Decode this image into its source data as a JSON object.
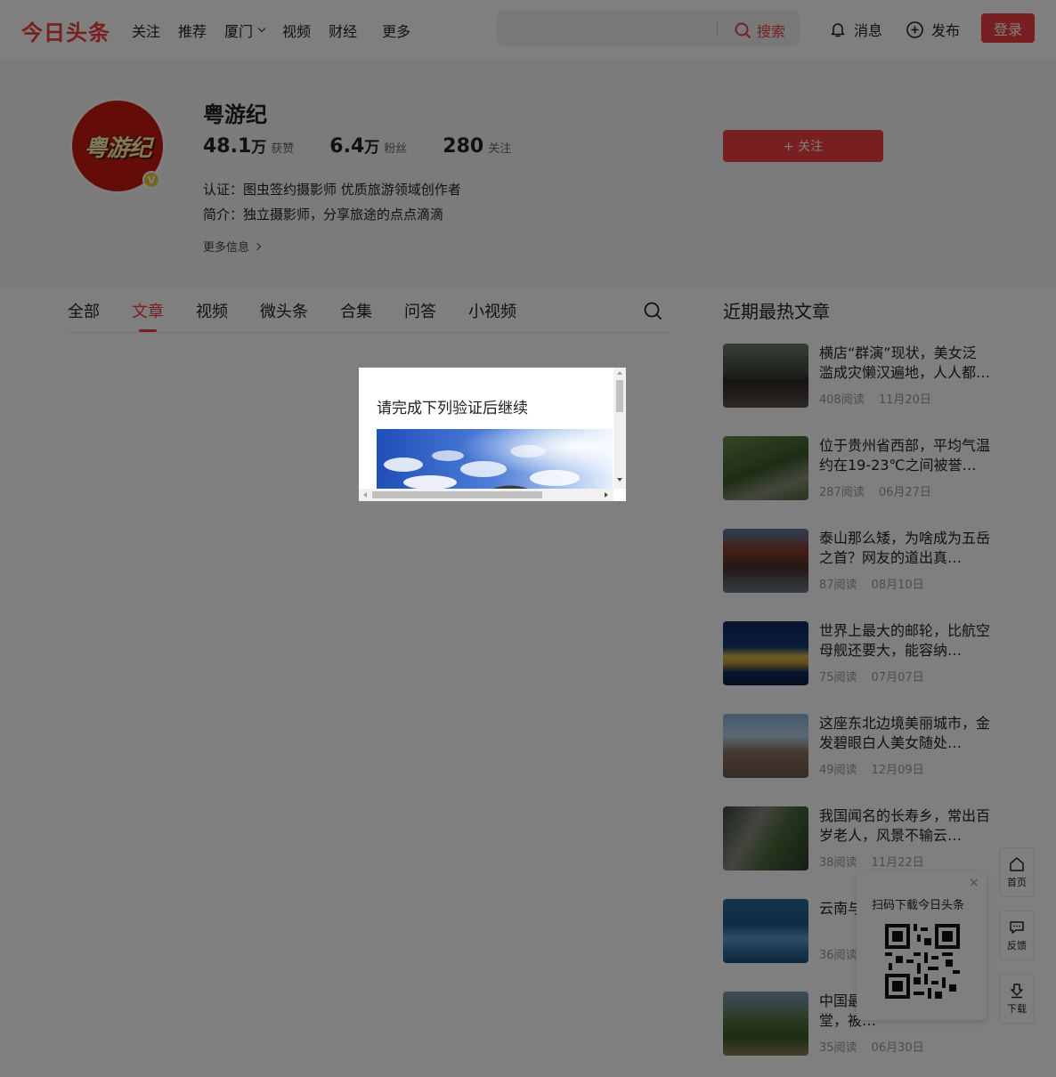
{
  "header": {
    "logo": "今日头条",
    "nav": [
      "关注",
      "推荐",
      "厦门",
      "视频",
      "财经"
    ],
    "nav_more": "更多",
    "search_button": "搜索",
    "search_placeholder": "",
    "messages": "消息",
    "publish": "发布",
    "login": "登录"
  },
  "profile": {
    "avatar_text": "粤游纪",
    "badge": "V",
    "name": "粤游纪",
    "stats": [
      {
        "num": "48.1",
        "unit": "万",
        "label": "获赞"
      },
      {
        "num": "6.4",
        "unit": "万",
        "label": "粉丝"
      },
      {
        "num": "280",
        "unit": "",
        "label": "关注"
      }
    ],
    "certification": "认证：图虫签约摄影师 优质旅游领域创作者",
    "intro": "简介：独立摄影师，分享旅途的点点滴滴",
    "more_info": "更多信息",
    "follow_button": "+ 关注"
  },
  "tabs": [
    "全部",
    "文章",
    "视频",
    "微头条",
    "合集",
    "问答",
    "小视频"
  ],
  "active_tab": "文章",
  "hot": {
    "title": "近期最热文章",
    "articles": [
      {
        "title": "横店“群演”现状，美女泛滥成灾懒汉遍地，人人都…",
        "reads": "408阅读",
        "date": "11月20日"
      },
      {
        "title": "位于贵州省西部，平均气温约在19-23℃之间被誉…",
        "reads": "287阅读",
        "date": "06月27日"
      },
      {
        "title": "泰山那么矮，为啥成为五岳之首？网友的道出真…",
        "reads": "87阅读",
        "date": "08月10日"
      },
      {
        "title": "世界上最大的邮轮，比航空母舰还要大，能容纳…",
        "reads": "75阅读",
        "date": "07月07日"
      },
      {
        "title": "这座东北边境美丽城市，金发碧眼白人美女随处…",
        "reads": "49阅读",
        "date": "12月09日"
      },
      {
        "title": "我国闻名的长寿乡，常出百岁老人，风景不输云…",
        "reads": "38阅读",
        "date": "11月22日"
      },
      {
        "title": "云南与…地，当…",
        "reads": "36阅读",
        "date": ""
      },
      {
        "title": "中国最…城，探险者的天堂，被…",
        "reads": "35阅读",
        "date": "06月30日"
      }
    ]
  },
  "float": {
    "home": "首页",
    "feedback": "反馈",
    "download": "下载",
    "qr_close": "×",
    "qr_text": "扫码下载今日头条"
  },
  "modal": {
    "title": "请完成下列验证后继续"
  },
  "colors": {
    "accent": "#f04142",
    "overlay": "rgba(0,0,0,0.5)"
  }
}
